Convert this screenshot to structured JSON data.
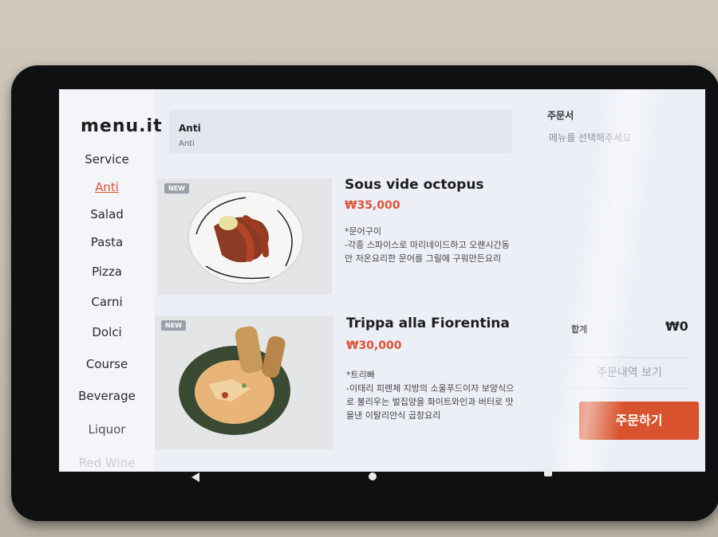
{
  "app": {
    "logo": "menu.it"
  },
  "sidebar": {
    "categories": [
      {
        "label": "Service",
        "active": false
      },
      {
        "label": "Anti",
        "active": true
      },
      {
        "label": "Salad",
        "active": false
      },
      {
        "label": "Pasta",
        "active": false
      },
      {
        "label": "Pizza",
        "active": false
      },
      {
        "label": "Carni",
        "active": false
      },
      {
        "label": "Dolci",
        "active": false
      },
      {
        "label": "Course",
        "active": false
      },
      {
        "label": "Beverage",
        "active": false
      },
      {
        "label": "Liquor",
        "active": false
      },
      {
        "label": "Red Wine",
        "active": false
      }
    ]
  },
  "section": {
    "title": "Anti",
    "subtitle": "Anti"
  },
  "menu_items": [
    {
      "badge": "NEW",
      "name": "Sous vide octopus",
      "price": "₩35,000",
      "desc_line1": "*문어구이",
      "desc_line2": "-각종 스파이스로 마리네이드하고 오랜시간동",
      "desc_line3": "안 저온요리한 문어를 그릴에 구워만든요리"
    },
    {
      "badge": "NEW",
      "name": "Trippa alla Fiorentina",
      "price": "₩30,000",
      "desc_line1": "*트리빠",
      "desc_line2": "-이태리 피렌체 지방의 소울푸드이자 보양식으",
      "desc_line3": "로 불리우는 벌집양을 화이트와인과 버터로 맛",
      "desc_line4": "을낸 이탈리안식 곱창요리"
    }
  ],
  "order": {
    "title": "주문서",
    "empty_text": "메뉴를 선택해주세요",
    "total_label": "합계",
    "total_value": "₩0",
    "history_label": "주문내역 보기",
    "submit_label": "주문하기"
  },
  "colors": {
    "accent": "#e0523a",
    "order_button": "#d8532d"
  },
  "icons": {
    "nav_back": "back-triangle-icon",
    "nav_home": "home-circle-icon",
    "nav_recent": "recent-square-icon"
  }
}
